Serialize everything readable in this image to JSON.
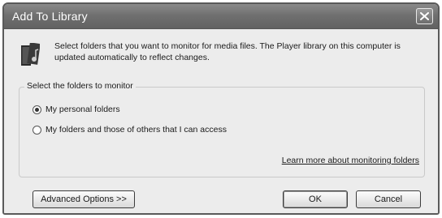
{
  "window": {
    "title": "Add To Library",
    "close_icon": "close-x-icon"
  },
  "header": {
    "icon": "media-library-icon",
    "description": "Select folders that you want to monitor for media files. The Player library on this computer is updated automatically to reflect changes."
  },
  "group": {
    "label": "Select the folders to monitor",
    "options": [
      {
        "label": "My personal folders",
        "selected": true
      },
      {
        "label": "My folders and those of others that I can access",
        "selected": false
      }
    ],
    "link_label": "Learn more about monitoring folders"
  },
  "buttons": {
    "advanced_label": "Advanced Options >>",
    "ok_label": "OK",
    "cancel_label": "Cancel"
  }
}
